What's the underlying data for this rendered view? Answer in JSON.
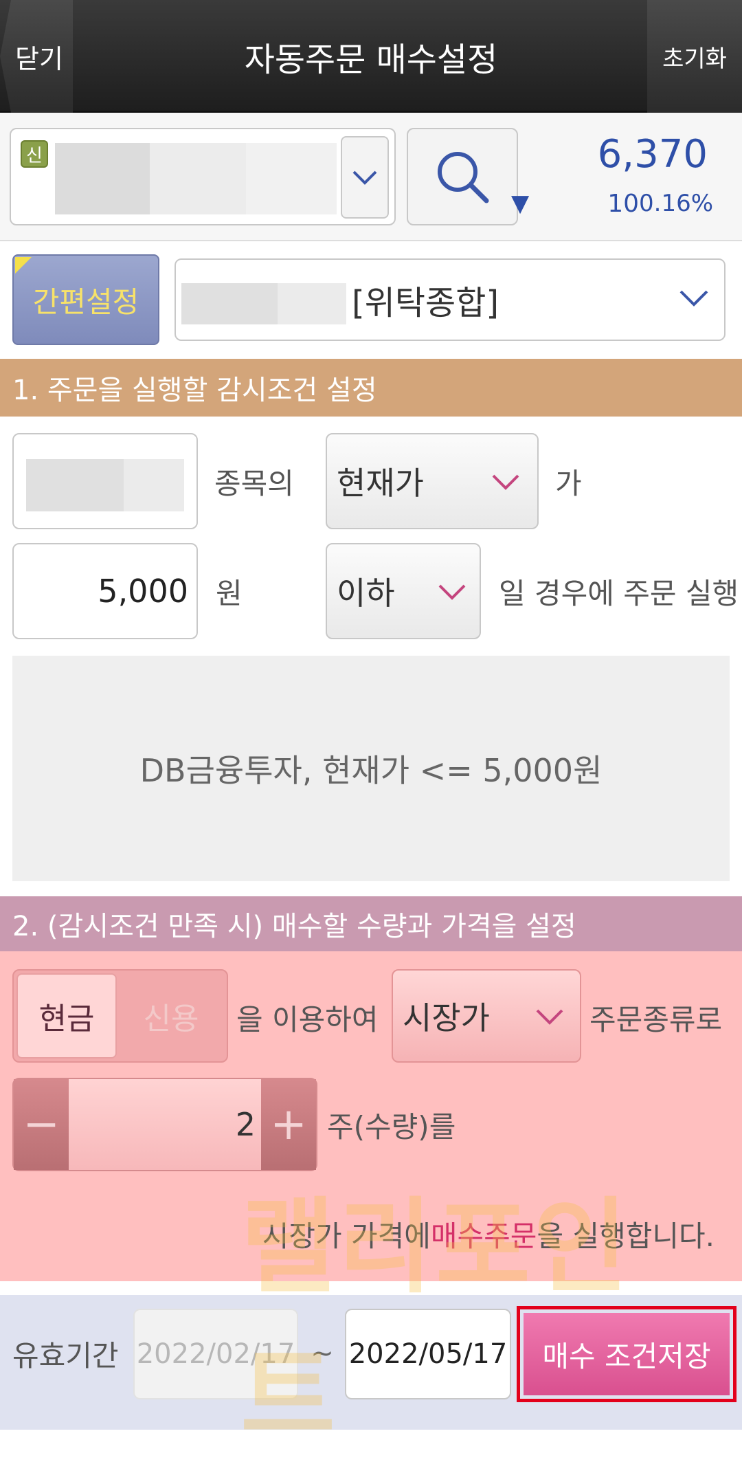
{
  "header": {
    "close_label": "닫기",
    "title": "자동주문 매수설정",
    "reset_label": "초기화"
  },
  "stock": {
    "credit_badge": "신",
    "price": "6,370",
    "change": "10",
    "change_rate": "0.16%",
    "direction_icon": "down-triangle-icon"
  },
  "account": {
    "quick_setting_label": "간편설정",
    "account_type": "[위탁종합]"
  },
  "section1": {
    "title": "1. 주문을 실행할 감시조건 설정",
    "stock_suffix": "종목의",
    "price_type": "현재가",
    "price_type_suffix": "가",
    "amount": "5,000",
    "amount_unit": "원",
    "condition": "이하",
    "condition_suffix": "일 경우에 주문 실행",
    "summary": "DB금융투자, 현재가 <= 5,000원"
  },
  "section2": {
    "title": "2. (감시조건 만족 시) 매수할 수량과 가격을 설정",
    "cash_label": "현금",
    "credit_label": "신용",
    "use_suffix": "을 이용하여",
    "order_type": "시장가",
    "order_type_suffix": "주문종류로",
    "quantity": "2",
    "quantity_suffix": "주(수량)를",
    "exec_prefix": "시장가 가격에 ",
    "exec_emphasis": "매수주문",
    "exec_suffix": "을 실행합니다."
  },
  "footer": {
    "valid_label": "유효기간",
    "date_from": "2022/02/17",
    "tilde": "~",
    "date_to": "2022/05/17",
    "save_label": "매수 조건저장"
  },
  "watermark": "랠리포인트",
  "colors": {
    "section1": "#d3a57a",
    "section2": "#c99ab0",
    "pink_area": "#ffbfbf",
    "price_blue": "#2e4fa8",
    "save_button": "#e0609c",
    "highlight_red": "#e3001b"
  }
}
